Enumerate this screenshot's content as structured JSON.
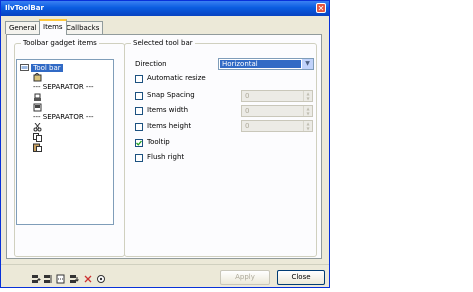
{
  "window": {
    "title": "IlvToolBar",
    "close_glyph": "✕"
  },
  "tabs": [
    {
      "label": "General"
    },
    {
      "label": "Items"
    },
    {
      "label": "Callbacks"
    }
  ],
  "left_group": {
    "legend": "Toolbar gadget items",
    "tree": [
      {
        "label": "Tool bar",
        "icon": "toolbar-icon"
      },
      {
        "label": "",
        "icon": "tool-icon"
      },
      {
        "label": "--- SEPARATOR ---",
        "icon": ""
      },
      {
        "label": "",
        "icon": "tool-icon"
      },
      {
        "label": "",
        "icon": "tool-icon"
      },
      {
        "label": "--- SEPARATOR ---",
        "icon": ""
      },
      {
        "label": "",
        "icon": "cut-icon"
      },
      {
        "label": "",
        "icon": "copy-icon"
      },
      {
        "label": "",
        "icon": "paste-icon"
      }
    ],
    "toolbar_icons": [
      "add-item-icon",
      "insert-item-icon",
      "add-separator-icon",
      "move-icon",
      "delete-icon",
      "settings-icon"
    ]
  },
  "right_group": {
    "legend": "Selected tool bar",
    "direction_label": "Direction",
    "direction_value": "Horizontal",
    "checkboxes": [
      {
        "label": "Automatic resize",
        "checked": false
      },
      {
        "label": "Snap Spacing",
        "checked": false
      },
      {
        "label": "Items width",
        "checked": false
      },
      {
        "label": "Items height",
        "checked": false
      },
      {
        "label": "Tooltip",
        "checked": true
      },
      {
        "label": "Flush right",
        "checked": false
      }
    ],
    "spins": [
      {
        "value": "0"
      },
      {
        "value": "0"
      },
      {
        "value": "0"
      }
    ]
  },
  "buttons": {
    "apply": "Apply",
    "close": "Close"
  }
}
